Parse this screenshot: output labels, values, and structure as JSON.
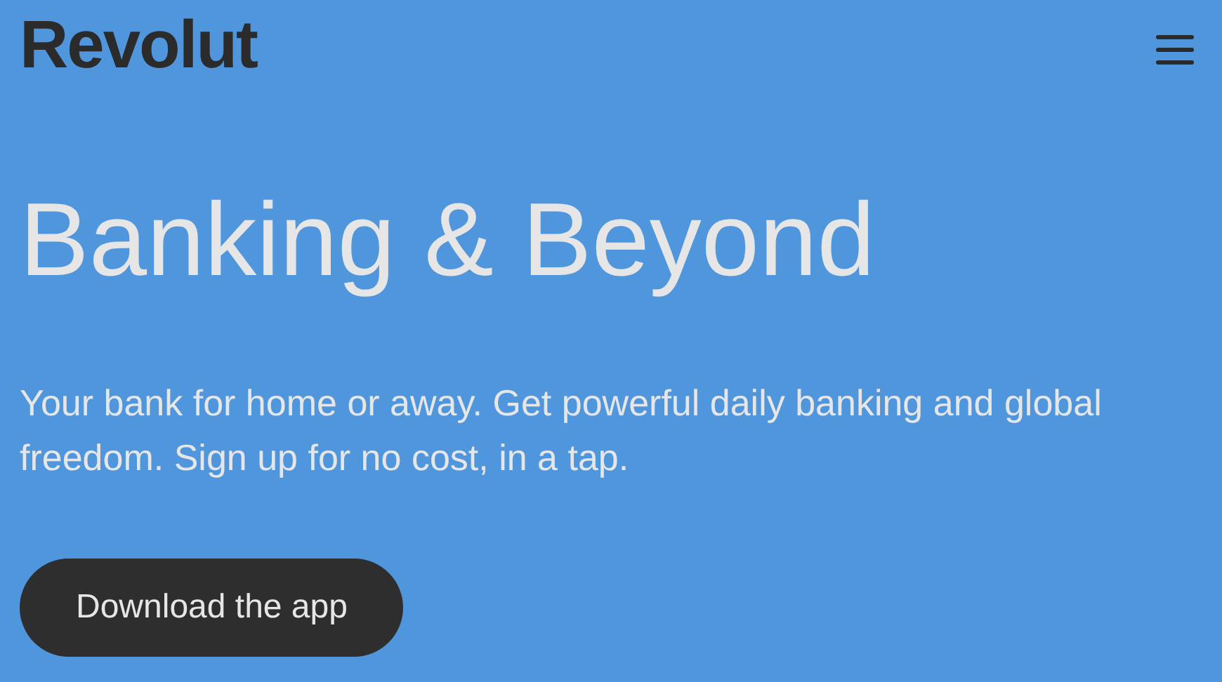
{
  "header": {
    "logo": "Revolut"
  },
  "hero": {
    "title": "Banking & Beyond",
    "subtitle": "Your bank for home or away. Get powerful daily banking and global freedom. Sign up for no cost, in a tap.",
    "button": "Download the app"
  }
}
